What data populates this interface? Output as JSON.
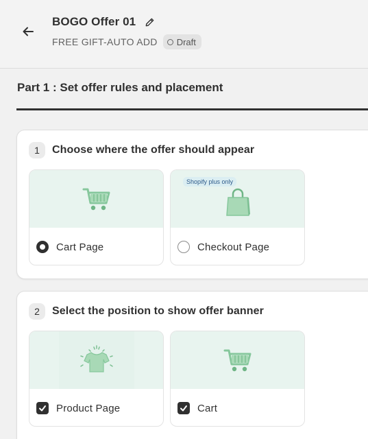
{
  "header": {
    "title": "BOGO Offer 01",
    "subtitle": "FREE GIFT-AUTO ADD",
    "status_badge": "Draft",
    "icons": {
      "back": "arrow-left-icon",
      "edit": "pencil-icon",
      "badge": "circle-outline-icon"
    }
  },
  "section": {
    "title": "Part 1 : Set offer rules and placement"
  },
  "step1": {
    "number": "1",
    "label": "Choose where the offer should appear",
    "options": [
      {
        "label": "Cart Page",
        "selected": true,
        "icon": "shopping-cart-icon"
      },
      {
        "label": "Checkout Page",
        "selected": false,
        "icon": "shopping-bag-icon",
        "tag": "Shopify plus only"
      }
    ]
  },
  "step2": {
    "number": "2",
    "label": "Select the position to show offer banner",
    "options": [
      {
        "label": "Product Page",
        "checked": true,
        "icon": "tshirt-icon"
      },
      {
        "label": "Cart",
        "checked": true,
        "icon": "shopping-cart-icon"
      }
    ]
  },
  "colors": {
    "primary_text": "#303030",
    "secondary_text": "#616161",
    "illustration_bg": "#e8f4ef",
    "illustration_green": "#8fcca4",
    "badge_bg": "#e3e3e3",
    "page_bg": "#f1f1f1"
  }
}
